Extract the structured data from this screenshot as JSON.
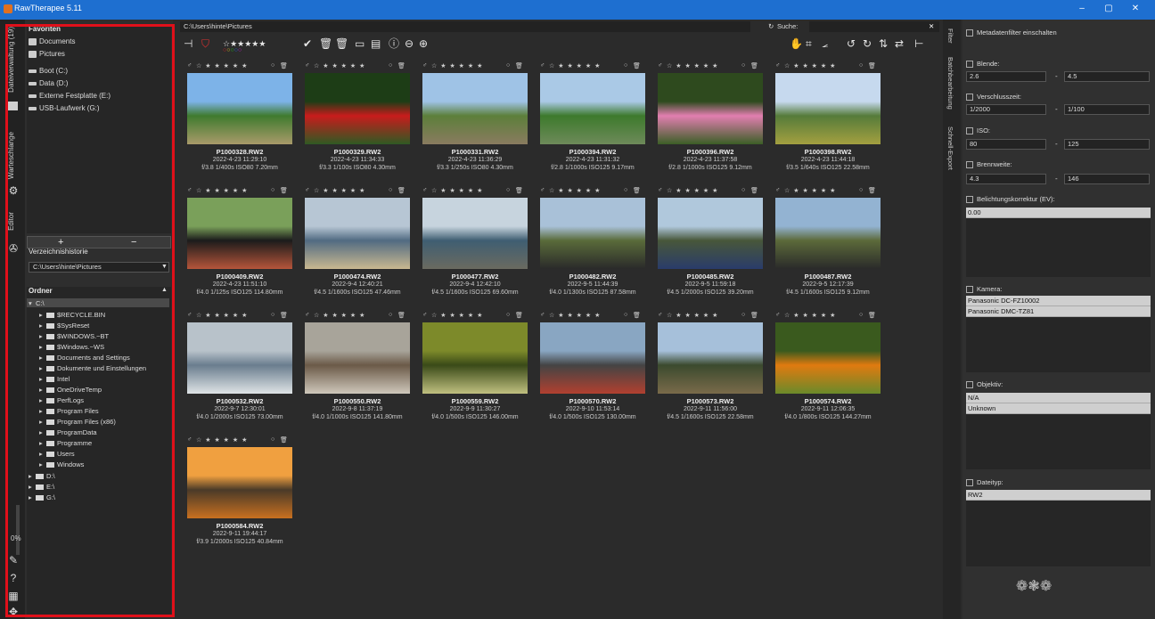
{
  "window": {
    "title": "RawTherapee 5.11"
  },
  "left_tabs": [
    {
      "label": "Dateiverwaltung (19)"
    },
    {
      "label": "Warteschlange"
    },
    {
      "label": "Editor"
    }
  ],
  "left_progress": "0%",
  "favorites": {
    "header": "Favoriten",
    "items": [
      "Documents",
      "Pictures"
    ],
    "places": [
      "Boot (C:)",
      "Data (D:)",
      "Externe Festplatte (E:)",
      "USB-Laufwerk (G:)"
    ],
    "add": "+",
    "remove": "−"
  },
  "history": {
    "header": "Verzeichnishistorie",
    "value": "C:\\Users\\hinte\\Pictures"
  },
  "folders": {
    "header": "Ordner",
    "root": "C:\\",
    "items": [
      "$RECYCLE.BIN",
      "$SysReset",
      "$WINDOWS.~BT",
      "$Windows.~WS",
      "Documents and Settings",
      "Dokumente und Einstellungen",
      "Intel",
      "OneDriveTemp",
      "PerfLogs",
      "Program Files",
      "Program Files (x86)",
      "ProgramData",
      "Programme",
      "Users",
      "Windows"
    ],
    "drives": [
      "D:\\",
      "E:\\",
      "G:\\"
    ]
  },
  "path": "C:\\Users\\hinte\\Pictures",
  "search": {
    "label": "Suche:",
    "value": ""
  },
  "thumbnails": [
    {
      "name": "P1000328.RW2",
      "date": "2022-4-23 11:29:10",
      "exif": "f/3.8 1/400s ISO80 7.20mm",
      "colors": [
        "#7db3e8",
        "#3f7a2e",
        "#a99a6a"
      ]
    },
    {
      "name": "P1000329.RW2",
      "date": "2022-4-23 11:34:33",
      "exif": "f/3.3 1/100s ISO80 4.30mm",
      "colors": [
        "#1d3d16",
        "#c81c1c",
        "#2f5a23"
      ]
    },
    {
      "name": "P1000331.RW2",
      "date": "2022-4-23 11:36:29",
      "exif": "f/3.3 1/250s ISO80 4.30mm",
      "colors": [
        "#9fc3e6",
        "#5c7f3a",
        "#8a7b60"
      ]
    },
    {
      "name": "P1000394.RW2",
      "date": "2022-4-23 11:31:32",
      "exif": "f/2.8 1/1000s ISO125 9.17mm",
      "colors": [
        "#aac9e6",
        "#3d7a2c",
        "#6e8a5a"
      ]
    },
    {
      "name": "P1000396.RW2",
      "date": "2022-4-23 11:37:58",
      "exif": "f/2.8 1/1000s ISO125 9.12mm",
      "colors": [
        "#2e4a1e",
        "#e27fb0",
        "#3b5f26"
      ]
    },
    {
      "name": "P1000398.RW2",
      "date": "2022-4-23 11:44:18",
      "exif": "f/3.5 1/640s ISO125 22.58mm",
      "colors": [
        "#c6d9ee",
        "#557b3a",
        "#a4a040"
      ]
    },
    {
      "name": "P1000409.RW2",
      "date": "2022-4-23 11:51:10",
      "exif": "f/4.0 1/125s ISO125 114.80mm",
      "colors": [
        "#7aa05a",
        "#1b1b1b",
        "#b5553a"
      ]
    },
    {
      "name": "P1000474.RW2",
      "date": "2022-9-4 12:40:21",
      "exif": "f/4.5 1/1600s ISO125 47.46mm",
      "colors": [
        "#b7c6d4",
        "#516b82",
        "#c9b890"
      ]
    },
    {
      "name": "P1000477.RW2",
      "date": "2022-9-4 12:42:10",
      "exif": "f/4.5 1/1600s ISO125 69.60mm",
      "colors": [
        "#c7d4de",
        "#3f5e72",
        "#6a6a60"
      ]
    },
    {
      "name": "P1000482.RW2",
      "date": "2022-9-5 11:44:39",
      "exif": "f/4.0 1/1300s ISO125 87.58mm",
      "colors": [
        "#a9c1d8",
        "#5a6b3a",
        "#2a2a2a"
      ]
    },
    {
      "name": "P1000485.RW2",
      "date": "2022-9-5 11:59:18",
      "exif": "f/4.5 1/2000s ISO125 39.20mm",
      "colors": [
        "#b0c8dc",
        "#48573a",
        "#2a3c6a"
      ]
    },
    {
      "name": "P1000487.RW2",
      "date": "2022-9-5 12:17:39",
      "exif": "f/4.5 1/1600s ISO125 9.12mm",
      "colors": [
        "#93b3d2",
        "#5c6a3a",
        "#2a2a2a"
      ]
    },
    {
      "name": "P1000532.RW2",
      "date": "2022-9-7 12:30:01",
      "exif": "f/4.0 1/2000s ISO125 73.00mm",
      "colors": [
        "#b8c2ca",
        "#6a7d8e",
        "#dfe4e6"
      ]
    },
    {
      "name": "P1000550.RW2",
      "date": "2022-9-8 11:37:19",
      "exif": "f/4.0 1/1000s ISO125 141.80mm",
      "colors": [
        "#a8a49a",
        "#6b5a48",
        "#cfc8bb"
      ]
    },
    {
      "name": "P1000559.RW2",
      "date": "2022-9-9 11:30:27",
      "exif": "f/4.0 1/500s ISO125 146.00mm",
      "colors": [
        "#7d8a2a",
        "#3a4a18",
        "#c0c080"
      ]
    },
    {
      "name": "P1000570.RW2",
      "date": "2022-9-10 11:53:14",
      "exif": "f/4.0 1/500s ISO125 130.00mm",
      "colors": [
        "#89a6c2",
        "#444444",
        "#b24030"
      ]
    },
    {
      "name": "P1000573.RW2",
      "date": "2022-9-11 11:56:00",
      "exif": "f/4.5 1/1600s ISO125 22.58mm",
      "colors": [
        "#a6c0da",
        "#3b4a2e",
        "#7a6a4a"
      ]
    },
    {
      "name": "P1000574.RW2",
      "date": "2022-9-11 12:06:35",
      "exif": "f/4.0 1/800s ISO125 144.27mm",
      "colors": [
        "#3a5a1e",
        "#e07a10",
        "#6a8a2a"
      ]
    },
    {
      "name": "P1000584.RW2",
      "date": "2022-9-11 19:44:17",
      "exif": "f/3.9 1/2000s ISO125 40.84mm",
      "colors": [
        "#f0a040",
        "#4a3a28",
        "#c87020"
      ]
    }
  ],
  "right_tabs": [
    "Filter",
    "Batchbearbeitung",
    "Schnell-Export"
  ],
  "filter": {
    "metadata": "Metadatenfilter einschalten",
    "aperture": {
      "label": "Blende:",
      "from": "2.6",
      "to": "4.5"
    },
    "shutter": {
      "label": "Verschlusszeit:",
      "from": "1/2000",
      "to": "1/100"
    },
    "iso": {
      "label": "ISO:",
      "from": "80",
      "to": "125"
    },
    "focal": {
      "label": "Brennweite:",
      "from": "4.3",
      "to": "146"
    },
    "exposure": {
      "label": "Belichtungskorrektur (EV):",
      "items": [
        "0.00"
      ]
    },
    "camera": {
      "label": "Kamera:",
      "items": [
        "Panasonic DC-FZ10002",
        "Panasonic DMC-TZ81"
      ]
    },
    "lens": {
      "label": "Objektiv:",
      "items": [
        "N/A",
        "Unknown"
      ]
    },
    "filetype": {
      "label": "Dateityp:",
      "items": [
        "RW2"
      ]
    },
    "dash": "-"
  }
}
